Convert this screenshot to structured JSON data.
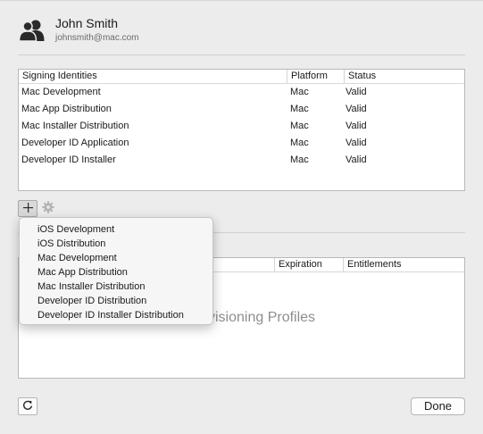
{
  "account": {
    "name": "John Smith",
    "email": "johnsmith@mac.com"
  },
  "signing_identities": {
    "columns": [
      "Signing Identities",
      "Platform",
      "Status"
    ],
    "rows": [
      [
        "Mac Development",
        "Mac",
        "Valid"
      ],
      [
        "Mac App Distribution",
        "Mac",
        "Valid"
      ],
      [
        "Mac Installer Distribution",
        "Mac",
        "Valid"
      ],
      [
        "Developer ID Application",
        "Mac",
        "Valid"
      ],
      [
        "Developer ID Installer",
        "Mac",
        "Valid"
      ]
    ]
  },
  "add_menu": {
    "items": [
      "iOS Development",
      "iOS Distribution",
      "Mac Development",
      "Mac App Distribution",
      "Mac Installer Distribution",
      "Developer ID Distribution",
      "Developer ID Installer Distribution"
    ]
  },
  "provisioning_profiles": {
    "columns": [
      "Expiration",
      "Entitlements"
    ],
    "empty_text": "visioning Profiles"
  },
  "buttons": {
    "plus": "+",
    "done": "Done"
  },
  "icons": {
    "avatar": "people-icon",
    "gear": "gear-icon",
    "refresh": "refresh-icon"
  }
}
